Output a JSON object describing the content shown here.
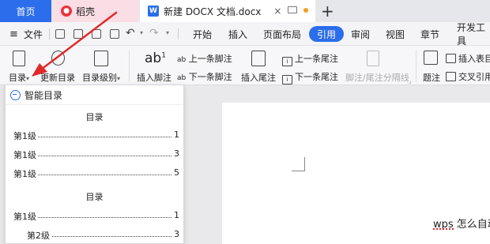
{
  "tabs": {
    "home": "首页",
    "daoke": "稻壳",
    "doc": "新建 DOCX 文档.docx",
    "close": "×",
    "add": "+"
  },
  "menubar": {
    "hamburger": "≡",
    "file": "文件",
    "undo": "↶",
    "redo": "↷",
    "caret": "▾",
    "tabs": [
      "开始",
      "插入",
      "页面布局",
      "引用",
      "审阅",
      "视图",
      "章节",
      "开发工具"
    ],
    "active_tab": "引用"
  },
  "ribbon": {
    "toc": "目录",
    "toc_caret": "▾",
    "update_toc": "更新目录",
    "toc_level": "目录级别",
    "toc_level_caret": "▾",
    "insert_footnote": "插入脚注",
    "footnote_glyph": "ab",
    "footnote_sup": "1",
    "prev_footnote": "上一条脚注",
    "next_footnote": "下一条脚注",
    "insert_endnote": "插入尾注",
    "prev_endnote": "上一条尾注",
    "next_endnote": "下一条尾注",
    "separator": "脚注/尾注分隔线",
    "caption": "题注",
    "insert_table_toc": "插入表目",
    "cross_ref": "交叉引用"
  },
  "dropdown": {
    "smart_toc": "智能目录",
    "preview1": {
      "title": "目录",
      "rows": [
        {
          "label": "第1级",
          "page": "1"
        },
        {
          "label": "第1级",
          "page": "3"
        },
        {
          "label": "第1级",
          "page": "5"
        }
      ]
    },
    "preview2": {
      "title": "目录",
      "rows": [
        {
          "label": "第1级",
          "page": "1"
        },
        {
          "label": "第2级",
          "page": "3"
        }
      ]
    }
  },
  "document": {
    "text": "wps 怎么自动"
  },
  "colors": {
    "accent": "#2b6dea",
    "arrow": "#e02a2a",
    "daoke_tab": "#fbdde6"
  }
}
